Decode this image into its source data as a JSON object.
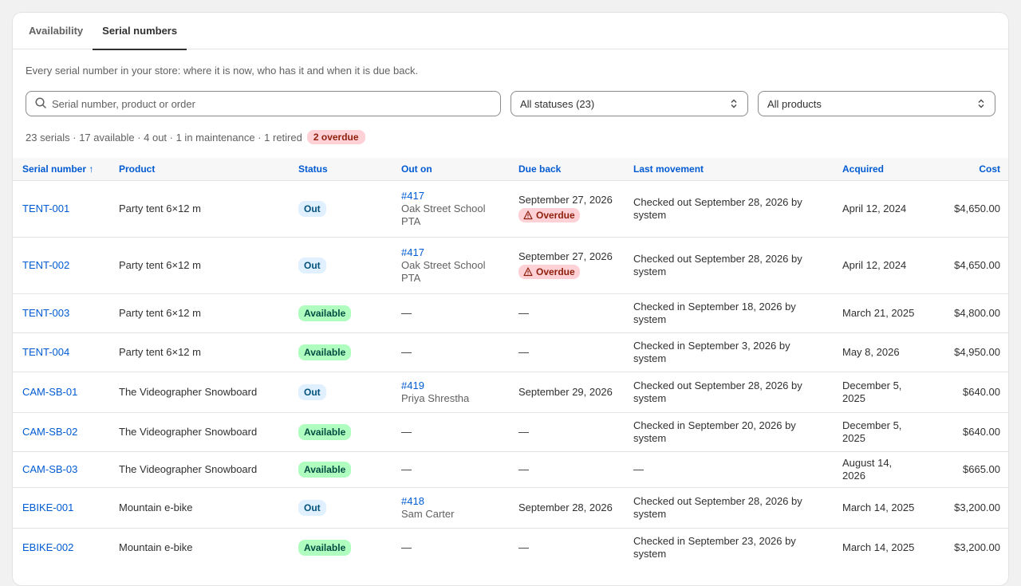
{
  "tabs": [
    {
      "label": "Availability",
      "active": false
    },
    {
      "label": "Serial numbers",
      "active": true
    }
  ],
  "description": "Every serial number in your store: where it is now, who has it and when it is due back.",
  "search": {
    "placeholder": "Serial number, product or order",
    "value": "",
    "icon": "search-icon"
  },
  "filters": {
    "status": "All statuses (23)",
    "product": "All products"
  },
  "summary": {
    "text": "23 serials · 17 available · 4 out · 1 in maintenance · 1 retired",
    "overdue_badge": "2 overdue"
  },
  "columns": {
    "serial": "Serial number ↑",
    "product": "Product",
    "status": "Status",
    "out_on": "Out on",
    "due_back": "Due back",
    "last_movement": "Last movement",
    "acquired": "Acquired",
    "cost": "Cost"
  },
  "colors": {
    "link": "#005bd3",
    "out_badge_bg": "#e0f0ff",
    "available_badge_bg": "#affebf",
    "overdue_bg": "#fed1d7"
  },
  "rows": [
    {
      "serial": "TENT-001",
      "product": "Party tent 6×12 m",
      "status": "Out",
      "status_kind": "out",
      "order": "#417",
      "customer": "Oak Street School PTA",
      "due": "September 27, 2026",
      "overdue": "Overdue",
      "movement": "Checked out September 28, 2026 by system",
      "acquired": "April 12, 2024",
      "cost": "$4,650.00"
    },
    {
      "serial": "TENT-002",
      "product": "Party tent 6×12 m",
      "status": "Out",
      "status_kind": "out",
      "order": "#417",
      "customer": "Oak Street School PTA",
      "due": "September 27, 2026",
      "overdue": "Overdue",
      "movement": "Checked out September 28, 2026 by system",
      "acquired": "April 12, 2024",
      "cost": "$4,650.00"
    },
    {
      "serial": "TENT-003",
      "product": "Party tent 6×12 m",
      "status": "Available",
      "status_kind": "available",
      "order": "",
      "customer": "",
      "dash": "—",
      "due": "—",
      "overdue": "",
      "movement": "Checked in September 18, 2026 by system",
      "acquired": "March 21, 2025",
      "cost": "$4,800.00"
    },
    {
      "serial": "TENT-004",
      "product": "Party tent 6×12 m",
      "status": "Available",
      "status_kind": "available",
      "order": "",
      "customer": "",
      "dash": "—",
      "due": "—",
      "overdue": "",
      "movement": "Checked in September 3, 2026 by system",
      "acquired": "May 8, 2026",
      "cost": "$4,950.00"
    },
    {
      "serial": "CAM-SB-01",
      "product": "The Videographer Snowboard",
      "status": "Out",
      "status_kind": "out",
      "order": "#419",
      "customer": "Priya Shrestha",
      "due": "September 29, 2026",
      "overdue": "",
      "movement": "Checked out September 28, 2026 by system",
      "acquired": "December 5, 2025",
      "cost": "$640.00"
    },
    {
      "serial": "CAM-SB-02",
      "product": "The Videographer Snowboard",
      "status": "Available",
      "status_kind": "available",
      "order": "",
      "customer": "",
      "dash": "—",
      "due": "—",
      "overdue": "",
      "movement": "Checked in September 20, 2026 by system",
      "acquired": "December 5, 2025",
      "cost": "$640.00"
    },
    {
      "serial": "CAM-SB-03",
      "product": "The Videographer Snowboard",
      "status": "Available",
      "status_kind": "available",
      "order": "",
      "customer": "",
      "dash": "—",
      "due": "—",
      "overdue": "",
      "movement": "—",
      "acquired": "August 14, 2026",
      "cost": "$665.00"
    },
    {
      "serial": "EBIKE-001",
      "product": "Mountain e-bike",
      "status": "Out",
      "status_kind": "out",
      "order": "#418",
      "customer": "Sam Carter",
      "due": "September 28, 2026",
      "overdue": "",
      "movement": "Checked out September 28, 2026 by system",
      "acquired": "March 14, 2025",
      "cost": "$3,200.00"
    },
    {
      "serial": "EBIKE-002",
      "product": "Mountain e-bike",
      "status": "Available",
      "status_kind": "available",
      "order": "",
      "customer": "",
      "dash": "—",
      "due": "—",
      "overdue": "",
      "movement": "Checked in September 23, 2026 by system",
      "acquired": "March 14, 2025",
      "cost": "$3,200.00"
    }
  ]
}
